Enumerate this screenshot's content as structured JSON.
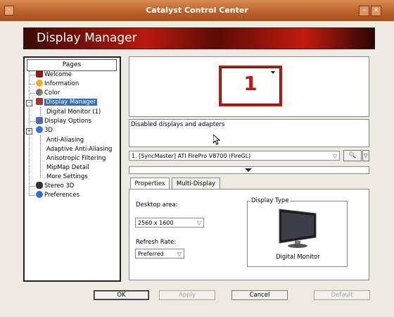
{
  "window": {
    "title": "Catalyst Control Center"
  },
  "header": {
    "title": "Display Manager"
  },
  "pages": {
    "heading": "Pages",
    "items": [
      {
        "label": "Welcome"
      },
      {
        "label": "Information"
      },
      {
        "label": "Color"
      },
      {
        "label": "Display Manager"
      },
      {
        "label": "Digital Monitor (1)"
      },
      {
        "label": "Display Options"
      },
      {
        "label": "3D"
      },
      {
        "label": "Anti-Aliasing"
      },
      {
        "label": "Adaptive Anti-Aliasing"
      },
      {
        "label": "Anisotropic Filtering"
      },
      {
        "label": "MipMap Detail"
      },
      {
        "label": "More Settings"
      },
      {
        "label": "Stereo 3D"
      },
      {
        "label": "Preferences"
      }
    ]
  },
  "monitor": {
    "number": "1"
  },
  "disabled": {
    "label": "Disabled displays and adapters"
  },
  "adapter": {
    "selected": "1. [SyncMaster] ATI FirePro V8700 (FireGL)"
  },
  "tabs": [
    {
      "label": "Properties"
    },
    {
      "label": "Multi-Display"
    }
  ],
  "properties": {
    "desktop_area_label": "Desktop area:",
    "desktop_area_value": "2560 x 1600",
    "refresh_rate_label": "Refresh Rate:",
    "refresh_rate_value": "Preferred",
    "display_type_label": "Display Type",
    "display_type_value": "Digital Monitor"
  },
  "buttons": {
    "ok": "OK",
    "apply": "Apply",
    "cancel": "Cancel",
    "default": "Default"
  },
  "colors": {
    "accent": "#c01812",
    "selection": "#2f6fbd"
  }
}
